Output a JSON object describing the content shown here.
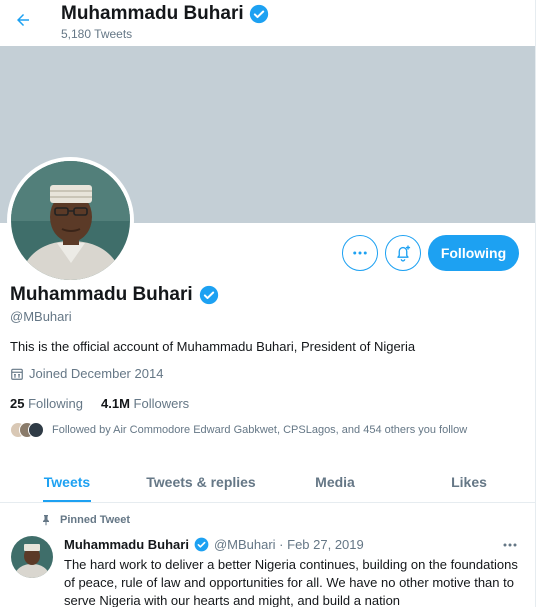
{
  "header": {
    "name": "Muhammadu Buhari",
    "tweet_count": "5,180 Tweets"
  },
  "profile": {
    "name": "Muhammadu Buhari",
    "handle": "@MBuhari",
    "bio": "This is the official account of Muhammadu Buhari, President of Nigeria",
    "joined": "Joined December 2014",
    "following_count": "25",
    "following_label": "Following",
    "followers_count": "4.1M",
    "followers_label": "Followers",
    "followed_by": "Followed by Air Commodore Edward Gabkwet, CPSLagos, and 454 others you follow"
  },
  "actions": {
    "more_icon": "more-horizontal-icon",
    "bell_icon": "bell-plus-icon",
    "following_button": "Following"
  },
  "tabs": [
    {
      "label": "Tweets",
      "active": true
    },
    {
      "label": "Tweets & replies",
      "active": false
    },
    {
      "label": "Media",
      "active": false
    },
    {
      "label": "Likes",
      "active": false
    }
  ],
  "tweet": {
    "pinned_label": "Pinned Tweet",
    "name": "Muhammadu Buhari",
    "handle_date": "@MBuhari · Feb 27, 2019",
    "text": "The hard work to deliver a better Nigeria continues, building on the foundations of peace, rule of law and opportunities for all. We have no other motive than to serve Nigeria with our hearts and might, and build a nation"
  },
  "colors": {
    "accent": "#1da1f2",
    "banner": "#c4cfd6",
    "secondary_text": "#657786"
  }
}
